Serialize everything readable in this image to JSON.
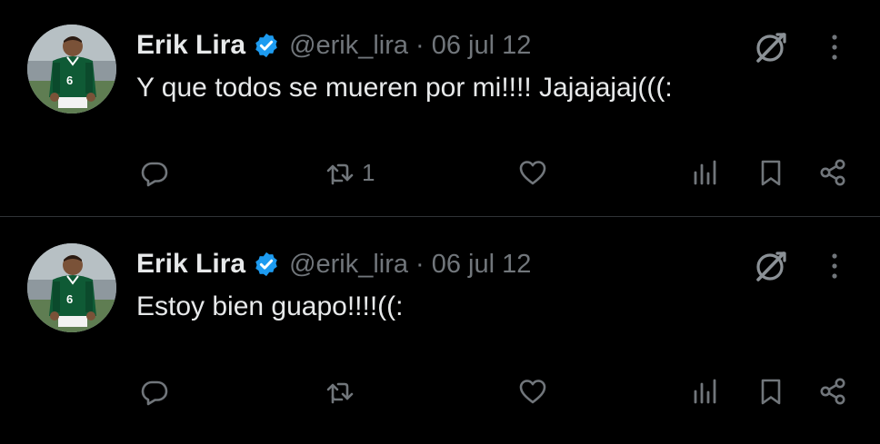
{
  "tweets": [
    {
      "author_name": "Erik Lira",
      "handle": "@erik_lira",
      "separator": "·",
      "date": "06 jul 12",
      "text": "Y que todos se mueren por mi!!!! Jajajajaj(((:",
      "retweet_count": "1",
      "reply_count": "",
      "like_count": ""
    },
    {
      "author_name": "Erik Lira",
      "handle": "@erik_lira",
      "separator": "·",
      "date": "06 jul 12",
      "text": "Estoy bien guapo!!!!((:",
      "retweet_count": "",
      "reply_count": "",
      "like_count": ""
    }
  ],
  "colors": {
    "background": "#000000",
    "text_primary": "#e7e9ea",
    "text_secondary": "#71767b",
    "verified_badge": "#1d9bf0",
    "divider": "#2f3336"
  },
  "icons": [
    "verified-badge-icon",
    "grok-icon",
    "more-icon",
    "reply-icon",
    "retweet-icon",
    "like-icon",
    "views-icon",
    "bookmark-icon",
    "share-icon"
  ]
}
